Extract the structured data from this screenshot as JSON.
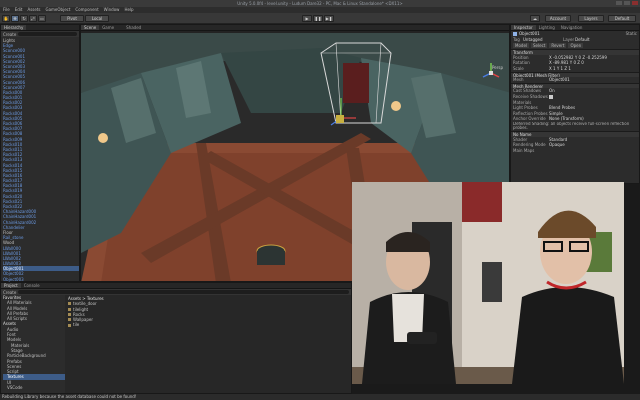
{
  "window": {
    "title": "Unity 5.0.0f4 - level.unity - Ludum Dare32 - PC, Mac & Linux Standalone* <DX11>"
  },
  "menu": [
    "File",
    "Edit",
    "Assets",
    "GameObject",
    "Component",
    "Window",
    "Help"
  ],
  "toolbar": {
    "pivot_label": "Pivot",
    "local_label": "Local",
    "account_label": "Account",
    "layers_label": "Layers",
    "layout_label": "Default"
  },
  "hierarchy": {
    "tab": "Hierarchy",
    "create_label": "Create",
    "rows": [
      {
        "label": "Lights",
        "type": "plain"
      },
      {
        "label": "Edge",
        "type": "link"
      },
      {
        "label": "Sconce000",
        "type": "link"
      },
      {
        "label": "Sconce001",
        "type": "link"
      },
      {
        "label": "Sconce002",
        "type": "link"
      },
      {
        "label": "Sconce003",
        "type": "link"
      },
      {
        "label": "Sconce004",
        "type": "link"
      },
      {
        "label": "Sconce005",
        "type": "link"
      },
      {
        "label": "Sconce006",
        "type": "link"
      },
      {
        "label": "Sconce007",
        "type": "link"
      },
      {
        "label": "Rocks000",
        "type": "link"
      },
      {
        "label": "Rocks001",
        "type": "link"
      },
      {
        "label": "Rocks002",
        "type": "link"
      },
      {
        "label": "Rocks003",
        "type": "link"
      },
      {
        "label": "Rocks004",
        "type": "link"
      },
      {
        "label": "Rocks005",
        "type": "link"
      },
      {
        "label": "Rocks006",
        "type": "link"
      },
      {
        "label": "Rocks007",
        "type": "link"
      },
      {
        "label": "Rocks008",
        "type": "link"
      },
      {
        "label": "Rocks009",
        "type": "link"
      },
      {
        "label": "Rocks010",
        "type": "link"
      },
      {
        "label": "Rocks011",
        "type": "link"
      },
      {
        "label": "Rocks012",
        "type": "link"
      },
      {
        "label": "Rocks013",
        "type": "link"
      },
      {
        "label": "Rocks014",
        "type": "link"
      },
      {
        "label": "Rocks015",
        "type": "link"
      },
      {
        "label": "Rocks016",
        "type": "link"
      },
      {
        "label": "Rocks017",
        "type": "link"
      },
      {
        "label": "Rocks018",
        "type": "link"
      },
      {
        "label": "Rocks019",
        "type": "link"
      },
      {
        "label": "Rocks020",
        "type": "link"
      },
      {
        "label": "Rocks021",
        "type": "link"
      },
      {
        "label": "Rocks022",
        "type": "link"
      },
      {
        "label": "ChainHazard000",
        "type": "link"
      },
      {
        "label": "ChainHazard001",
        "type": "link"
      },
      {
        "label": "ChainHazard002",
        "type": "link"
      },
      {
        "label": "Chandelier",
        "type": "link"
      },
      {
        "label": "Floor",
        "type": "plain"
      },
      {
        "label": "Rail_stone",
        "type": "link"
      },
      {
        "label": "Wood",
        "type": "plain"
      },
      {
        "label": "LWall000",
        "type": "link"
      },
      {
        "label": "LWall001",
        "type": "link"
      },
      {
        "label": "LWall002",
        "type": "link"
      },
      {
        "label": "LWall003",
        "type": "link"
      },
      {
        "label": "Object001",
        "type": "selected"
      },
      {
        "label": "Object002",
        "type": "link"
      },
      {
        "label": "Object003",
        "type": "link"
      },
      {
        "label": "Object004",
        "type": "link"
      },
      {
        "label": "Object005",
        "type": "link"
      }
    ]
  },
  "scene": {
    "tabs": [
      "Scene",
      "Game"
    ],
    "shading_label": "Shaded",
    "gizmo_label": "Persp"
  },
  "inspector": {
    "tabs": [
      "Inspector",
      "Lighting",
      "Navigation"
    ],
    "object_name": "Object001",
    "static_label": "Static",
    "tag_label": "Tag",
    "tag_value": "Untagged",
    "layer_label": "Layer",
    "layer_value": "Default",
    "model_tabs": [
      "Model",
      "Select",
      "Revert",
      "Open"
    ],
    "transform_header": "Transform",
    "position_label": "Position",
    "position_value": "X -0.052982  Y 0  Z -0.252599",
    "rotation_label": "Rotation",
    "rotation_value": "X -89.981  Y 0  Z 0",
    "scale_label": "Scale",
    "scale_value": "X 1  Y 1  Z 1",
    "mesh_filter_header": "Object001 (Mesh Filter)",
    "mesh_label": "Mesh",
    "mesh_value": "Object001",
    "renderer_header": "Mesh Renderer",
    "cast_shadows_label": "Cast Shadows",
    "cast_shadows_value": "On",
    "receive_shadows_label": "Receive Shadows",
    "materials_label": "Materials",
    "light_probes_label": "Light Probes",
    "light_probes_value": "Blend Probes",
    "reflection_probes_label": "Reflection Probes",
    "reflection_probes_value": "Simple",
    "anchor_override_label": "Anchor Override",
    "anchor_override_value": "None (Transform)",
    "info_text": "Deferred Shading: all objects receive full-screen reflection probes.",
    "material_name": "No Name",
    "shader_label": "Shader",
    "shader_value": "Standard",
    "rendering_mode_label": "Rendering Mode",
    "rendering_mode_value": "Opaque",
    "main_maps_label": "Main Maps"
  },
  "project": {
    "tabs": [
      "Project",
      "Console"
    ],
    "create_label": "Create",
    "favorites": [
      "Favorites",
      "All Materials",
      "All Models",
      "All Prefabs",
      "All Scripts"
    ],
    "tree": [
      "Assets",
      "Audio",
      "Font",
      "Models",
      "Materials",
      "Stage",
      "ParticleBackground",
      "Prefabs",
      "Scenes",
      "Script",
      "Textures",
      "UI",
      "VSCode"
    ],
    "selected": "Textures",
    "breadcrumb": "Assets > Textures",
    "files": [
      "textile_door",
      "tilelight",
      "Rocks",
      "Wallpaper",
      "tile"
    ]
  },
  "status": {
    "text": "Rebuilding Library because the asset database could not be found!"
  },
  "colors": {
    "accent": "#3d5c88",
    "link": "#6c9be4",
    "panel": "#2c2c2c",
    "floor": "#8a4a33"
  }
}
